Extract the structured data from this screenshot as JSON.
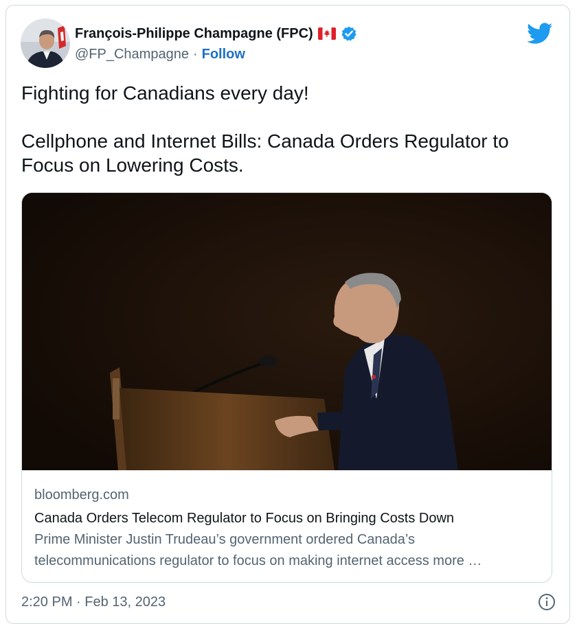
{
  "tweet": {
    "author_name": "François-Philippe Champagne (FPC)",
    "handle": "@FP_Champagne",
    "separator": "·",
    "follow_label": "Follow",
    "text_line1": "Fighting for Canadians every day!",
    "text_line2": "Cellphone and Internet Bills: Canada Orders Regulator to Focus on Lowering Costs.",
    "timestamp": "2:20 PM · Feb 13, 2023"
  },
  "link_card": {
    "domain": "bloomberg.com",
    "headline": "Canada Orders Telecom Regulator to Focus on Bringing Costs Down",
    "description_line1": "Prime Minister Justin Trudeau’s government ordered Canada’s",
    "description_line2": "telecommunications regulator to focus on making internet access more …"
  },
  "icons": {
    "flag": "canada-flag-icon",
    "verified": "verified-badge-icon",
    "brand": "twitter-bird-icon",
    "info": "info-icon"
  },
  "colors": {
    "twitter_blue": "#1d9bf0",
    "follow_blue": "#1d70c4",
    "text_primary": "#0f1419",
    "text_secondary": "#536471",
    "border": "#cfd9de"
  }
}
